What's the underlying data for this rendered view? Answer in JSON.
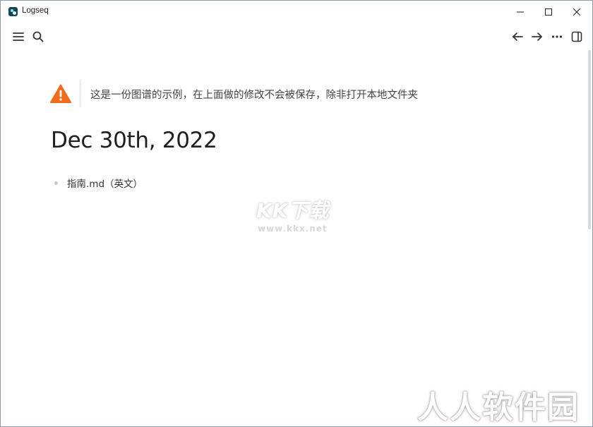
{
  "window": {
    "title": "Logseq"
  },
  "icons": {
    "app": "logseq-logo-icon",
    "minimize": "minimize-icon",
    "maximize": "maximize-icon",
    "close": "close-icon",
    "menu": "hamburger-menu-icon",
    "search": "search-icon",
    "back": "arrow-left-icon",
    "forward": "arrow-right-icon",
    "more": "more-horizontal-icon",
    "sidebar": "right-sidebar-toggle-icon",
    "warning": "warning-triangle-icon"
  },
  "colors": {
    "warning": "#f26b1d",
    "title_text": "#1f1f1f",
    "bullet": "#c8c8c8"
  },
  "notice": {
    "text": "这是一份图谱的示例，在上面做的修改不会被保存，除非打开本地文件夹"
  },
  "page": {
    "title": "Dec 30th, 2022",
    "blocks": [
      {
        "text": "指南.md（英文）"
      }
    ]
  },
  "watermarks": {
    "kk": "KK下载",
    "kk_url": "www.kkx.net",
    "rr": "人人软件园"
  }
}
